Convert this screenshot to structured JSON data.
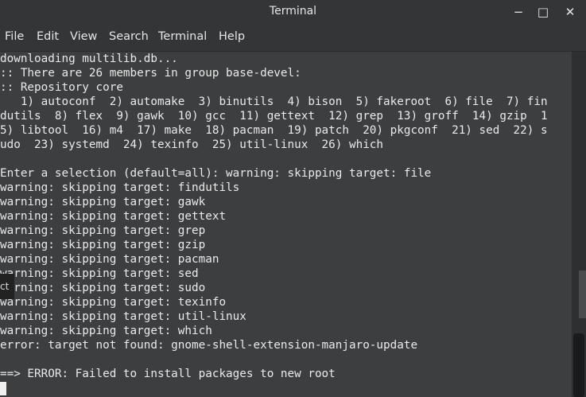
{
  "window": {
    "title": "Terminal",
    "minimize_glyph": "−",
    "maximize_glyph": "□",
    "close_glyph": "✕"
  },
  "menu": {
    "items": [
      "File",
      "Edit",
      "View",
      "Search",
      "Terminal",
      "Help"
    ]
  },
  "terminal": {
    "lines": [
      "downloading multilib.db...",
      ":: There are 26 members in group base-devel:",
      ":: Repository core",
      "   1) autoconf  2) automake  3) binutils  4) bison  5) fakeroot  6) file  7) fin",
      "dutils  8) flex  9) gawk  10) gcc  11) gettext  12) grep  13) groff  14) gzip  1",
      "5) libtool  16) m4  17) make  18) pacman  19) patch  20) pkgconf  21) sed  22) s",
      "udo  23) systemd  24) texinfo  25) util-linux  26) which",
      "",
      "Enter a selection (default=all): warning: skipping target: file",
      "warning: skipping target: findutils",
      "warning: skipping target: gawk",
      "warning: skipping target: gettext",
      "warning: skipping target: grep",
      "warning: skipping target: gzip",
      "warning: skipping target: pacman",
      "warning: skipping target: sed",
      "warning: skipping target: sudo",
      "warning: skipping target: texinfo",
      "warning: skipping target: util-linux",
      "warning: skipping target: which",
      "error: target not found: gnome-shell-extension-manjaro-update",
      "",
      "==> ERROR: Failed to install packages to new root"
    ],
    "overlay_text": "ct"
  },
  "colors": {
    "background": "#3d3e40",
    "foreground": "#eaeaea",
    "titlebar": "#333537"
  }
}
